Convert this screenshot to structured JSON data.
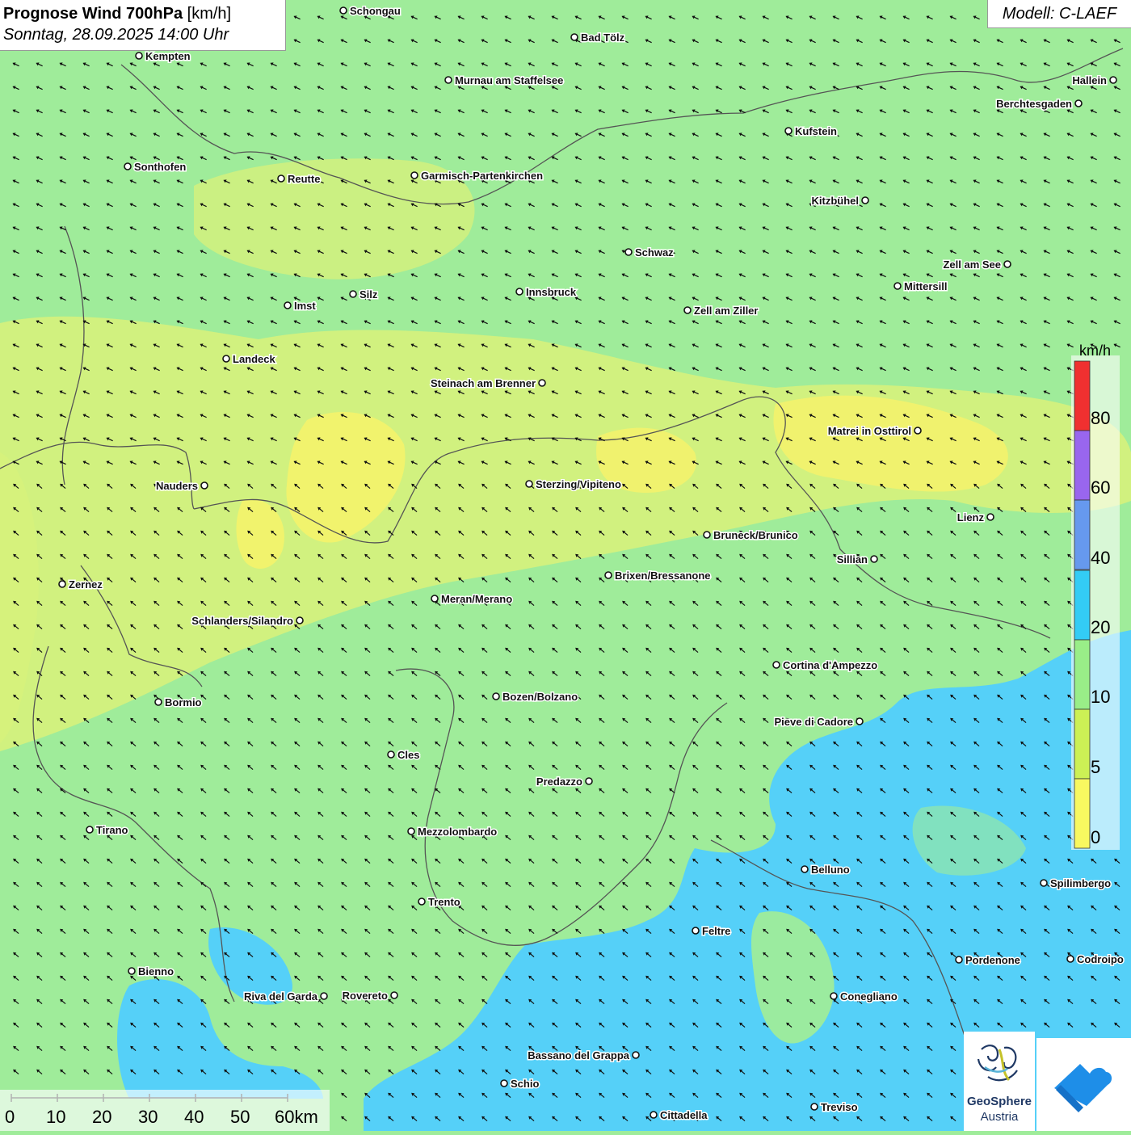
{
  "header": {
    "title_bold": "Prognose Wind 700hPa",
    "title_unit": " [km/h]",
    "date": "Sonntag, 28.09.2025 14:00 Uhr",
    "model": "Modell: C-LAEF"
  },
  "legend": {
    "unit": "km/h",
    "labels": [
      "80",
      "60",
      "40",
      "20",
      "10",
      "5",
      "0"
    ],
    "colors": [
      "#f03030",
      "#9966ee",
      "#6699ee",
      "#33ccf5",
      "#99ee88",
      "#ccf055",
      "#f8f860"
    ]
  },
  "scale_bar": {
    "labels": [
      "0",
      "10",
      "20",
      "30",
      "40",
      "50",
      "60km"
    ]
  },
  "logos": {
    "geosphere_line1": "GeoSphere",
    "geosphere_line2": "Austria"
  },
  "colors": {
    "land_green": "#9fec9a",
    "calm_yellow": "#f0f57a",
    "blue_zone": "#55d0f8",
    "border": "#555555"
  },
  "cities": [
    {
      "name": "Schongau"
    },
    {
      "name": "Bad Tölz"
    },
    {
      "name": "Kempten"
    },
    {
      "name": "Murnau am Staffelsee"
    },
    {
      "name": "Hallein"
    },
    {
      "name": "Berchtesgaden"
    },
    {
      "name": "Kufstein"
    },
    {
      "name": "Sonthofen"
    },
    {
      "name": "Reutte"
    },
    {
      "name": "Garmisch-Partenkirchen"
    },
    {
      "name": "Kitzbühel"
    },
    {
      "name": "Schwaz"
    },
    {
      "name": "Zell am See"
    },
    {
      "name": "Mittersill"
    },
    {
      "name": "Imst"
    },
    {
      "name": "Silz"
    },
    {
      "name": "Innsbruck"
    },
    {
      "name": "Zell am Ziller"
    },
    {
      "name": "Landeck"
    },
    {
      "name": "Steinach am Brenner"
    },
    {
      "name": "Matrei in Osttirol"
    },
    {
      "name": "Nauders"
    },
    {
      "name": "Sterzing/Vipiteno"
    },
    {
      "name": "Lienz"
    },
    {
      "name": "Bruneck/Brunico"
    },
    {
      "name": "Sillian"
    },
    {
      "name": "Zernez"
    },
    {
      "name": "Brixen/Bressanone"
    },
    {
      "name": "Meran/Merano"
    },
    {
      "name": "Schlanders/Silandro"
    },
    {
      "name": "Cortina d'Ampezzo"
    },
    {
      "name": "Bozen/Bolzano"
    },
    {
      "name": "Bormio"
    },
    {
      "name": "Pieve di Cadore"
    },
    {
      "name": "Cles"
    },
    {
      "name": "Predazzo"
    },
    {
      "name": "Tirano"
    },
    {
      "name": "Mezzolombardo"
    },
    {
      "name": "Belluno"
    },
    {
      "name": "Spilimbergo"
    },
    {
      "name": "Trento"
    },
    {
      "name": "Feltre"
    },
    {
      "name": "Pordenone"
    },
    {
      "name": "Codroipo"
    },
    {
      "name": "Bienno"
    },
    {
      "name": "Riva del Garda"
    },
    {
      "name": "Rovereto"
    },
    {
      "name": "Conegliano"
    },
    {
      "name": "Bassano del Grappa"
    },
    {
      "name": "Schio"
    },
    {
      "name": "Treviso"
    },
    {
      "name": "Cittadella"
    }
  ]
}
